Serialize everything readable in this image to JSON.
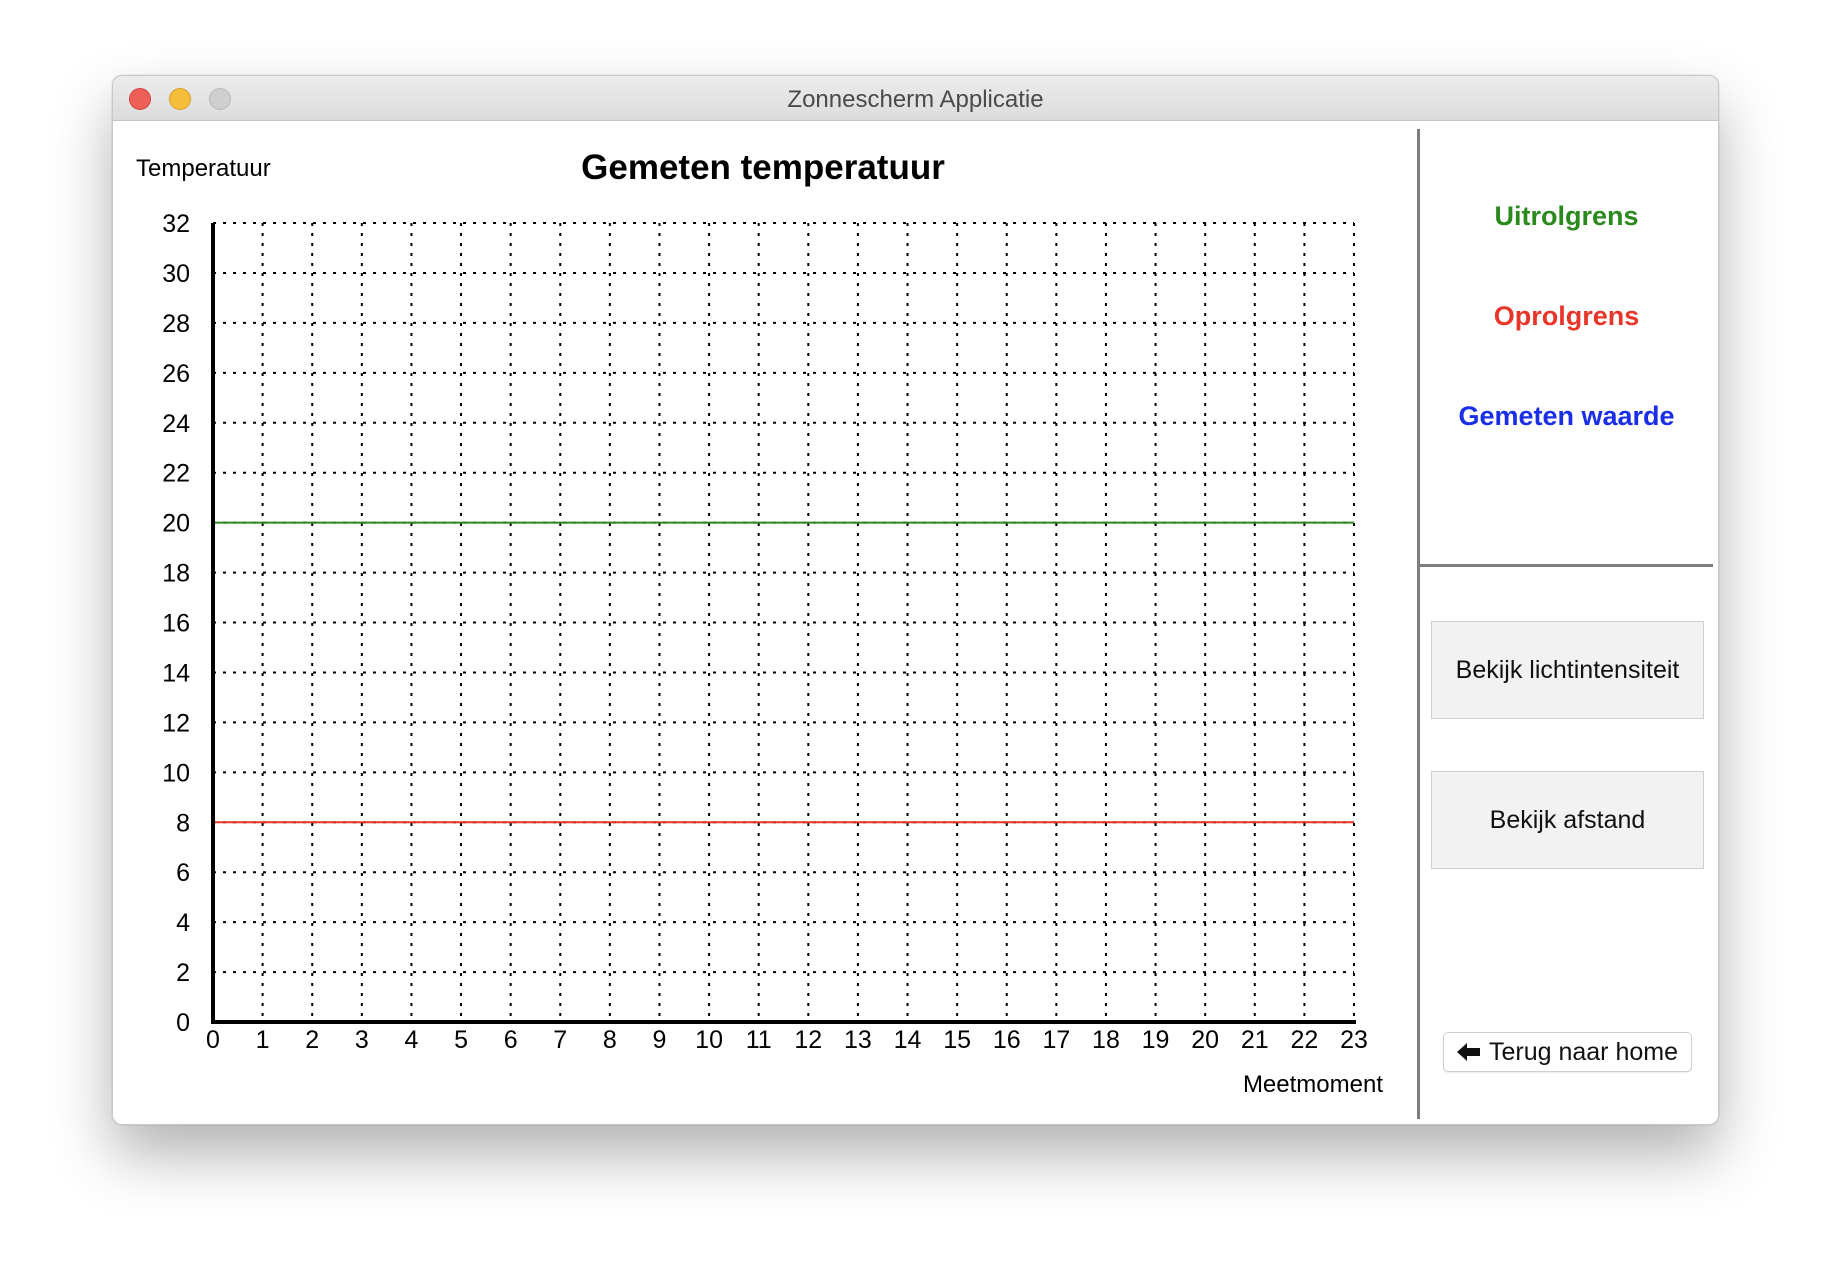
{
  "window": {
    "title": "Zonnescherm Applicatie"
  },
  "legend": {
    "items": [
      {
        "label": "Uitrolgrens",
        "color": "#2a8a1e"
      },
      {
        "label": "Oprolgrens",
        "color": "#e8352a"
      },
      {
        "label": "Gemeten waarde",
        "color": "#1a2ee8"
      }
    ]
  },
  "buttons": {
    "light": "Bekijk lichtintensiteit",
    "distance": "Bekijk afstand",
    "home": "Terug naar home",
    "home_icon": "arrow-left-icon"
  },
  "chart_data": {
    "type": "line",
    "title": "Gemeten temperatuur",
    "xlabel": "Meetmoment",
    "ylabel": "Temperatuur",
    "xlim": [
      0,
      23
    ],
    "ylim": [
      0,
      32
    ],
    "x_ticks": [
      0,
      1,
      2,
      3,
      4,
      5,
      6,
      7,
      8,
      9,
      10,
      11,
      12,
      13,
      14,
      15,
      16,
      17,
      18,
      19,
      20,
      21,
      22,
      23
    ],
    "y_ticks": [
      0,
      2,
      4,
      6,
      8,
      10,
      12,
      14,
      16,
      18,
      20,
      22,
      24,
      26,
      28,
      30,
      32
    ],
    "grid": true,
    "series": [
      {
        "name": "Uitrolgrens",
        "color": "#2a8a1e",
        "x": [
          0,
          23
        ],
        "y": [
          20,
          20
        ]
      },
      {
        "name": "Oprolgrens",
        "color": "#e8352a",
        "x": [
          0,
          23
        ],
        "y": [
          8,
          8
        ]
      },
      {
        "name": "Gemeten waarde",
        "color": "#1a2ee8",
        "x": [],
        "y": []
      }
    ]
  }
}
